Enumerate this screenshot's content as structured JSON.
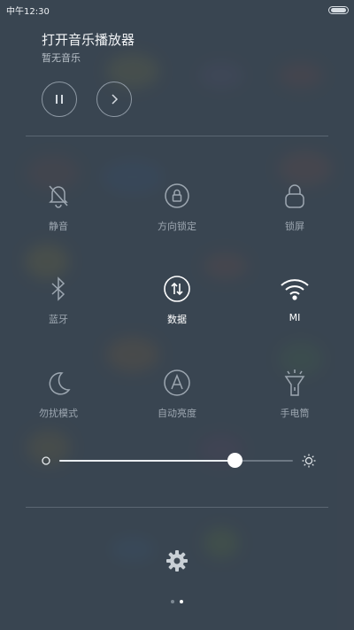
{
  "status_bar": {
    "time": "中午12:30",
    "battery_icon": "battery-icon"
  },
  "music": {
    "title": "打开音乐播放器",
    "subtitle": "暂无音乐",
    "pause_icon": "pause-icon",
    "next_icon": "chevron-right-icon"
  },
  "toggles": [
    {
      "label": "静音",
      "icon": "bell-off-icon",
      "active": false
    },
    {
      "label": "方向锁定",
      "icon": "rotation-lock-icon",
      "active": false
    },
    {
      "label": "锁屏",
      "icon": "lock-icon",
      "active": false
    },
    {
      "label": "蓝牙",
      "icon": "bluetooth-icon",
      "active": false
    },
    {
      "label": "数据",
      "icon": "mobile-data-icon",
      "active": true
    },
    {
      "label": "MI",
      "icon": "wifi-icon",
      "active": true
    },
    {
      "label": "勿扰模式",
      "icon": "moon-icon",
      "active": false
    },
    {
      "label": "自动亮度",
      "icon": "auto-brightness-icon",
      "active": false
    },
    {
      "label": "手电筒",
      "icon": "flashlight-icon",
      "active": false
    }
  ],
  "brightness": {
    "level": 0.75,
    "low_icon": "brightness-low-icon",
    "high_icon": "brightness-high-icon"
  },
  "settings_icon": "gear-icon",
  "pager": {
    "pages": 2,
    "current": 2
  },
  "colors": {
    "background": "#3a4551",
    "active": "#ffffff",
    "inactive": "#9da7b1"
  }
}
